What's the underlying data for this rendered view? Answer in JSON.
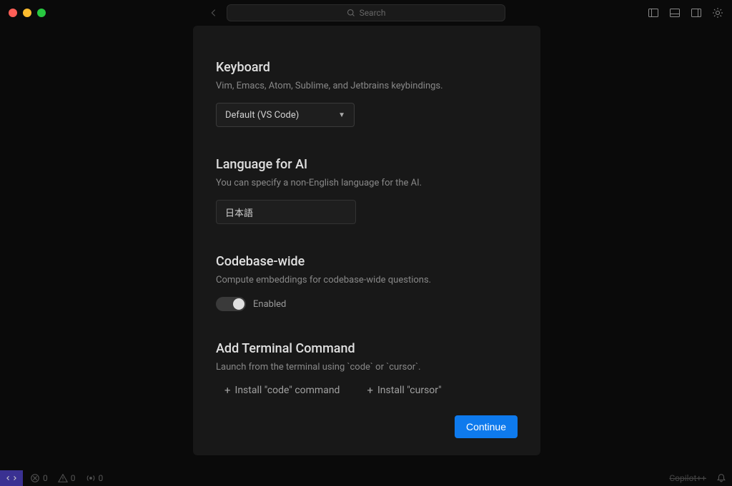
{
  "titlebar": {
    "search_placeholder": "Search"
  },
  "sections": {
    "keyboard": {
      "title": "Keyboard",
      "desc": "Vim, Emacs, Atom, Sublime, and Jetbrains keybindings.",
      "dropdown_value": "Default (VS Code)"
    },
    "language": {
      "title": "Language for AI",
      "desc": "You can specify a non-English language for the AI.",
      "input_value": "日本語"
    },
    "codebase": {
      "title": "Codebase-wide",
      "desc": "Compute embeddings for codebase-wide questions.",
      "toggle_label": "Enabled"
    },
    "terminal": {
      "title": "Add Terminal Command",
      "desc": "Launch from the terminal using `code` or `cursor`.",
      "install_code": "Install \"code\" command",
      "install_cursor": "Install \"cursor\""
    }
  },
  "footer": {
    "continue": "Continue"
  },
  "statusbar": {
    "errors": "0",
    "warnings": "0",
    "ports": "0",
    "copilot": "Copilot++"
  }
}
